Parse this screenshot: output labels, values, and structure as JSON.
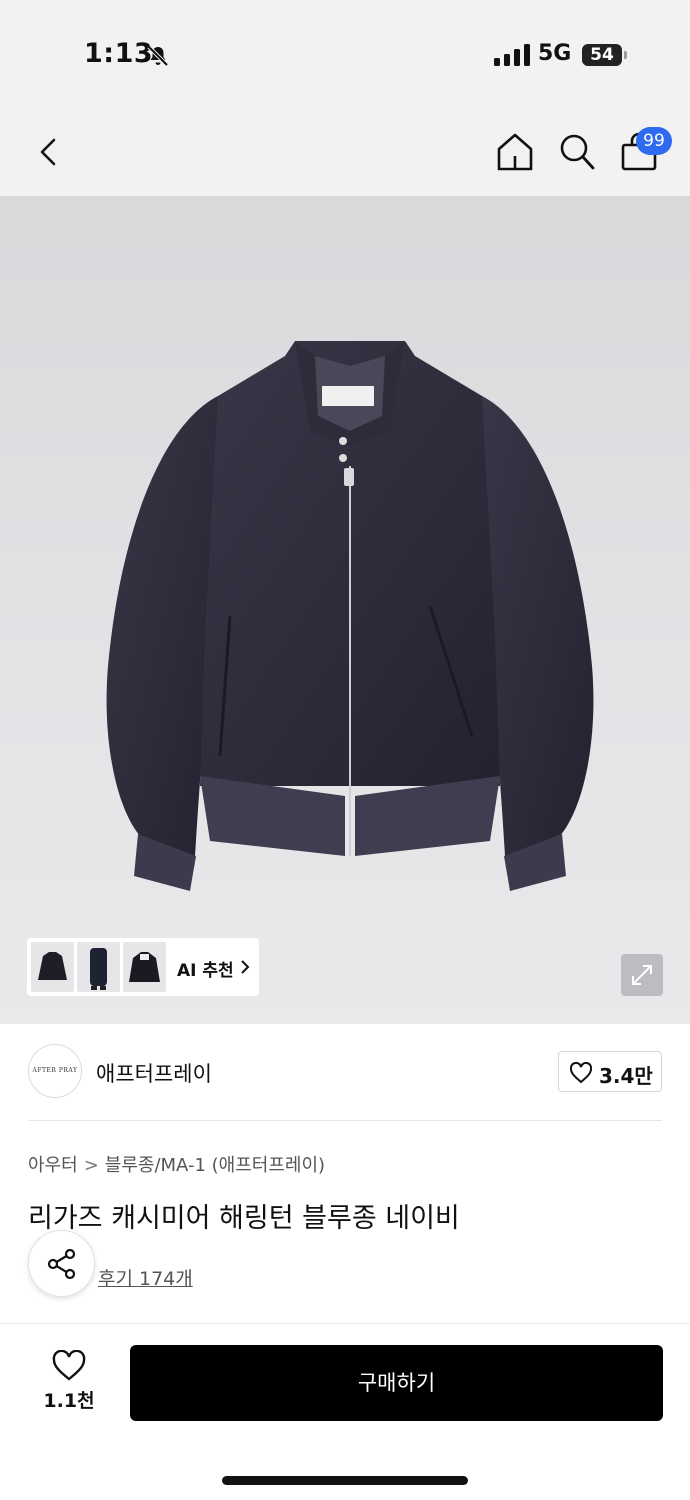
{
  "status_bar": {
    "time": "1:13",
    "network": "5G",
    "battery": "54",
    "icons": [
      "bell-slash-icon",
      "signal-icon",
      "battery-icon"
    ]
  },
  "nav": {
    "icons": [
      "back-icon",
      "home-icon",
      "search-icon",
      "cart-icon"
    ],
    "cart_badge": "99",
    "badge_color": "#2f6bf0"
  },
  "gallery": {
    "thumbnails": [
      "thumbnail-1",
      "thumbnail-2",
      "thumbnail-3"
    ],
    "ai_label": "AI 추천",
    "expand_icon": "expand-icon",
    "jacket_color": "#2a2838"
  },
  "brand": {
    "logo_text": "AFTER PRAY",
    "name": "애프터프레이",
    "like_count": "3.4만"
  },
  "product": {
    "breadcrumb": [
      "아우터",
      "블루종/MA-1 (애프터프레이)"
    ],
    "title": "리가즈 캐시미어 해링턴 블루종 네이비",
    "review_link": "후기 174개"
  },
  "bottom_bar": {
    "wish_count": "1.1천",
    "buy_label": "구매하기"
  }
}
